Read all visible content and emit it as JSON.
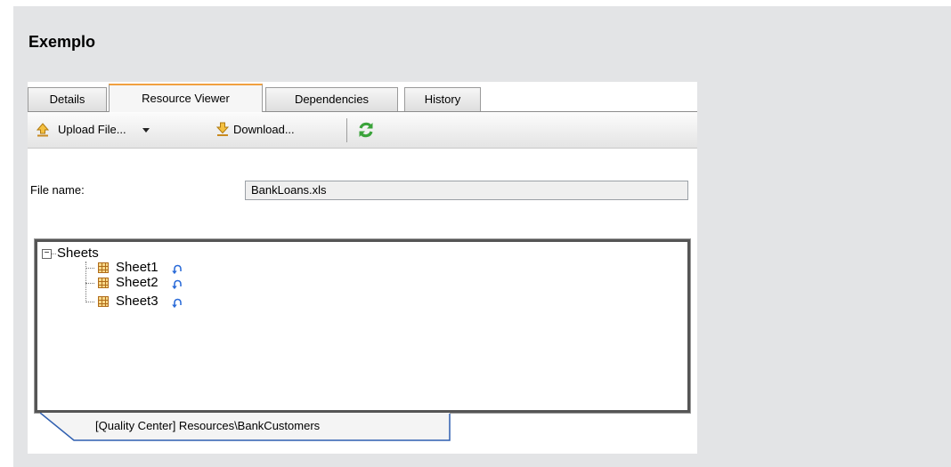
{
  "heading": "Exemplo",
  "tabs": [
    {
      "label": "Details",
      "active": false
    },
    {
      "label": "Resource Viewer",
      "active": true
    },
    {
      "label": "Dependencies",
      "active": false
    },
    {
      "label": "History",
      "active": false
    }
  ],
  "toolbar": {
    "upload_label": "Upload File...",
    "download_label": "Download...",
    "icons": [
      "upload-arrow-icon",
      "dropdown-arrow-icon",
      "download-arrow-icon",
      "refresh-icon"
    ]
  },
  "file": {
    "label": "File name:",
    "value": "BankLoans.xls"
  },
  "tree": {
    "root": "Sheets",
    "children": [
      "Sheet1",
      "Sheet2",
      "Sheet3"
    ]
  },
  "bottom_tab": {
    "label": "[Quality Center] Resources\\BankCustomers"
  },
  "colors": {
    "panel_bg": "#e3e4e6",
    "active_tab_accent": "#f0a040",
    "link_icon": "#2a6bd8",
    "bottom_tab_border": "#2f5fb0"
  }
}
